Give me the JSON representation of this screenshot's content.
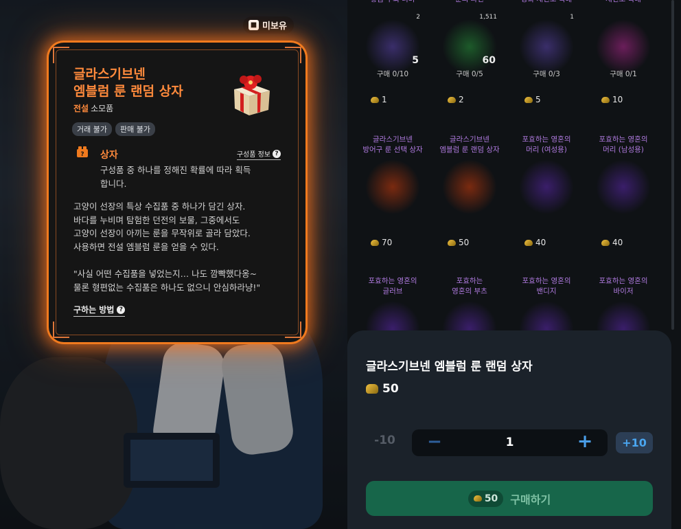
{
  "tooltip": {
    "owned_badge": "미보유",
    "title": "글라스기브넨\n엠블럼 룬 랜덤 상자",
    "title_line1": "글라스기브넨",
    "title_line2": "엠블럼 룬 랜덤 상자",
    "grade": "전설",
    "item_type": "소모품",
    "tags": [
      "거래 불가",
      "판매 불가"
    ],
    "category": "상자",
    "component_info": "구성품 정보",
    "category_desc": "구성품 중 하나를 정해진 확률에 따라 획득합니다.",
    "description": "고양이 선장의 특상 수집품 중 하나가 담긴 상자.\n바다를 누비며 탐험한 던전의  보물, 그중에서도\n고양이 선장이 아끼는 룬을 무작위로 골라 담았다.\n사용하면 전설 엠블럼 룬을 얻을 수 있다.\n\n\"사실 어떤 수집품을 넣었는지… 나도 깜빡했다옹~\n물론 형편없는 수집품은 하나도 없으니 안심하라냥!\"",
    "how_to_get": "구하는 방법",
    "colors": {
      "accent": "#ff8a3c",
      "glow": "#f07a1e"
    }
  },
  "shop": {
    "rows": [
      [
        {
          "name": "황금 주괴 더미",
          "owned": "2",
          "qty": "5",
          "stock": "구매 0/10",
          "price": "1",
          "icon": "gold-bars-icon",
          "glow": "#3a2e6a"
        },
        {
          "name": "룬의 파편",
          "owned": "1,511",
          "qty": "60",
          "stock": "구매 0/5",
          "price": "2",
          "icon": "rune-shards-icon",
          "glow": "#1d5a2a"
        },
        {
          "name": "강화 재연소 촉매",
          "owned": "1",
          "qty": "",
          "stock": "구매 0/3",
          "price": "5",
          "icon": "potion-icon",
          "glow": "#3a2e6a"
        },
        {
          "name": "재연소 촉매",
          "owned": "",
          "qty": "",
          "stock": "구매 0/1",
          "price": "10",
          "icon": "crystal-icon",
          "glow": "#6a1e5a"
        }
      ],
      [
        {
          "name": "글라스기브넨\n방어구 룬 선택 상자",
          "price": "70",
          "icon": "gift-box-icon",
          "glow": "#7a2a10"
        },
        {
          "name": "글라스기브넨\n엠블럼 룬 랜덤 상자",
          "price": "50",
          "icon": "gift-box-icon",
          "glow": "#7a2a10"
        },
        {
          "name": "포효하는 영혼의\n머리 (여성용)",
          "price": "40",
          "icon": "helmet-icon",
          "glow": "#3a1e6a"
        },
        {
          "name": "포효하는 영혼의\n머리 (남성용)",
          "price": "40",
          "icon": "helmet-icon",
          "glow": "#3a1e6a"
        }
      ],
      [
        {
          "name": "포효하는 영혼의\n글러브",
          "icon": "glove-icon",
          "glow": "#3a1e6a"
        },
        {
          "name": "포효하는\n영혼의 부츠",
          "icon": "boots-icon",
          "glow": "#3a1e6a"
        },
        {
          "name": "포효하는 영혼의\n밴디지",
          "icon": "bandage-icon",
          "glow": "#3a1e6a"
        },
        {
          "name": "포효하는 영혼의\n바이저",
          "icon": "visor-icon",
          "glow": "#3a1e6a"
        }
      ]
    ]
  },
  "purchase": {
    "item_name": "글라스기브넨 엠블럼 룬 랜덤 상자",
    "unit_price": "50",
    "minus10": "-10",
    "quantity": "1",
    "plus10": "+10",
    "total_price": "50",
    "buy_label": "구매하기",
    "colors": {
      "buy_bg": "#17664a",
      "plus": "#4a9ee8"
    }
  }
}
